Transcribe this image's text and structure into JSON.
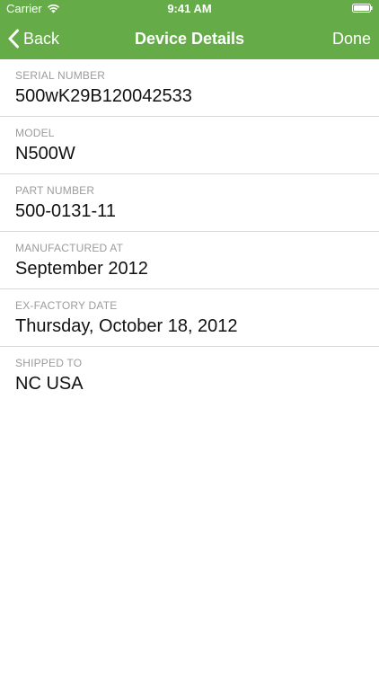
{
  "status_bar": {
    "carrier": "Carrier",
    "time": "9:41 AM"
  },
  "navbar": {
    "back_label": "Back",
    "title": "Device Details",
    "done_label": "Done",
    "background_color": "#65ac48"
  },
  "fields": [
    {
      "label": "SERIAL NUMBER",
      "value": "500wK29B120042533"
    },
    {
      "label": "MODEL",
      "value": "N500W"
    },
    {
      "label": "PART NUMBER",
      "value": "500-0131-11"
    },
    {
      "label": "MANUFACTURED AT",
      "value": "September 2012"
    },
    {
      "label": "EX-FACTORY DATE",
      "value": "Thursday, October 18, 2012"
    },
    {
      "label": "SHIPPED TO",
      "value": "NC USA"
    }
  ]
}
